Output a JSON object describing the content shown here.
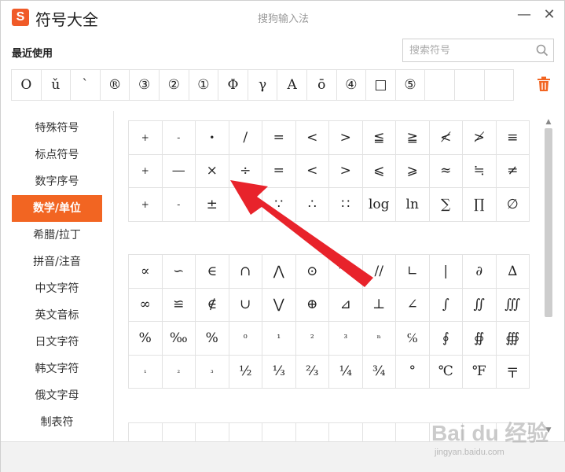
{
  "app": {
    "logo_letter": "S",
    "title": "符号大全",
    "window_title": "搜狗输入法",
    "minimize_glyph": "—",
    "close_glyph": "✕"
  },
  "recent": {
    "label": "最近使用",
    "symbols": [
      "O",
      "ǔ",
      "ˋ",
      "®",
      "③",
      "②",
      "①",
      "Φ",
      "γ",
      "A",
      "ō",
      "④",
      "□",
      "⑤",
      "",
      "",
      ""
    ]
  },
  "search": {
    "placeholder": "搜索符号"
  },
  "sidebar": {
    "items": [
      {
        "label": "特殊符号"
      },
      {
        "label": "标点符号"
      },
      {
        "label": "数字序号"
      },
      {
        "label": "数学/单位"
      },
      {
        "label": "希腊/拉丁"
      },
      {
        "label": "拼音/注音"
      },
      {
        "label": "中文字符"
      },
      {
        "label": "英文音标"
      },
      {
        "label": "日文字符"
      },
      {
        "label": "韩文字符"
      },
      {
        "label": "俄文字母"
      },
      {
        "label": "制表符"
      }
    ],
    "active_index": 3
  },
  "grid1": [
    "+",
    "-",
    "•",
    "/",
    "=",
    "<",
    ">",
    "≦",
    "≧",
    "≮",
    "≯",
    "≡",
    "+",
    "—",
    "×",
    "÷",
    "=",
    "<",
    ">",
    "⩽",
    "⩾",
    "≈",
    "≒",
    "≠",
    "+",
    "-",
    "±",
    "",
    "∵",
    "∴",
    "∷",
    "log",
    "ln",
    "∑",
    "∏",
    "∅"
  ],
  "grid2": [
    "∝",
    "∽",
    "∈",
    "∩",
    "⋀",
    "⊙",
    "⌒",
    "//",
    "∟",
    "|",
    "∂",
    "∆",
    "∞",
    "≌",
    "∉",
    "∪",
    "⋁",
    "⊕",
    "⊿",
    "⊥",
    "∠",
    "∫",
    "∬",
    "∭",
    "%",
    "‰",
    "%",
    "⁰",
    "¹",
    "²",
    "³",
    "ⁿ",
    "℅",
    "∮",
    "∯",
    "∰",
    "₁",
    "₂",
    "₃",
    "½",
    "⅓",
    "⅔",
    "¼",
    "¾",
    "°",
    "℃",
    "℉",
    "〒"
  ],
  "watermark": {
    "text": "Bai du 经验",
    "sub": "jingyan.baidu.com"
  },
  "colors": {
    "accent": "#f26522",
    "arrow": "#e8232b"
  }
}
